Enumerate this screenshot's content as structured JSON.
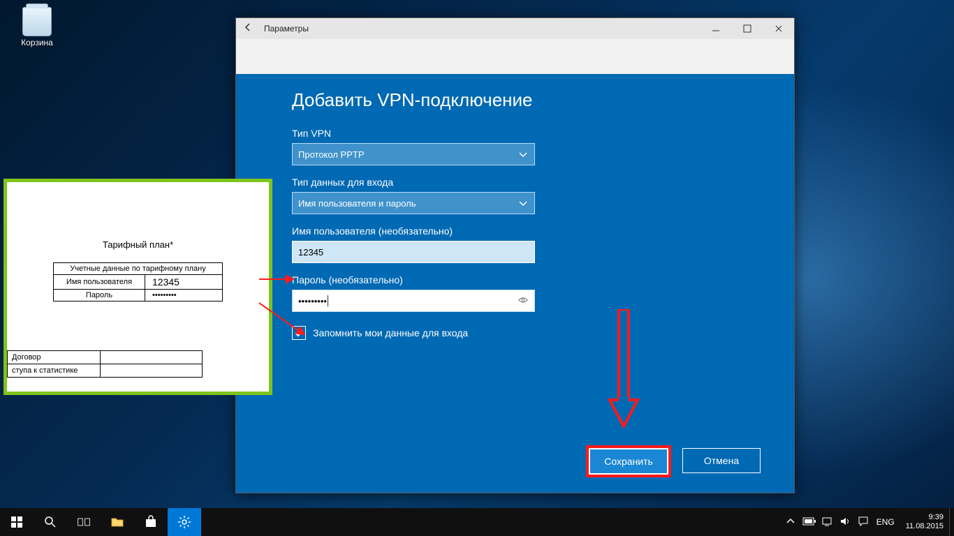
{
  "desktop": {
    "recycle_bin_label": "Корзина"
  },
  "settings_window": {
    "title": "Параметры"
  },
  "vpn_dialog": {
    "heading": "Добавить VPN-подключение",
    "vpn_type_label": "Тип VPN",
    "vpn_type_value": "Протокол PPTP",
    "signin_type_label": "Тип данных для входа",
    "signin_type_value": "Имя пользователя и пароль",
    "username_label": "Имя пользователя (необязательно)",
    "username_value": "12345",
    "password_label": "Пароль (необязательно)",
    "password_value_mask": "•••••••••",
    "remember_label": "Запомнить мои данные для входа",
    "save_button": "Сохранить",
    "cancel_button": "Отмена"
  },
  "doc": {
    "tariff_title": "Тарифный план*",
    "cred_header": "Учетные данные по тарифному плану",
    "cred_user_label": "Имя пользователя",
    "cred_user_value": "12345",
    "cred_pass_label": "Пароль",
    "cred_pass_mask": "•••••••••",
    "row1": "Договор",
    "row2": "ступа к статистике"
  },
  "taskbar": {
    "tray_lang": "ENG",
    "clock_time": "9:39",
    "clock_date": "11.08.2015"
  }
}
